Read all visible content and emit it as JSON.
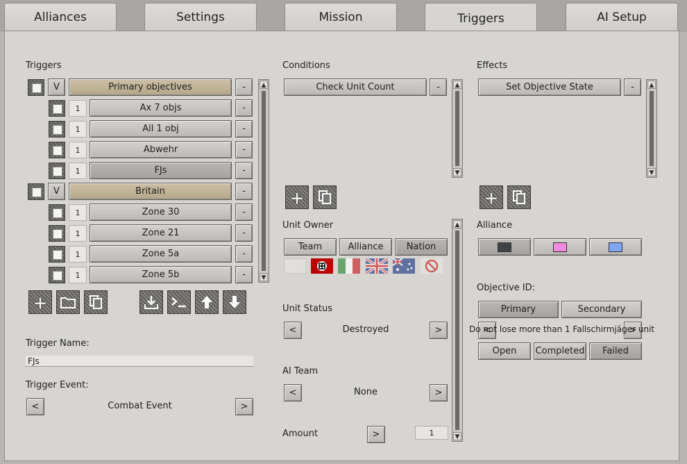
{
  "tabs": {
    "alliances": "Alliances",
    "settings": "Settings",
    "mission": "Mission",
    "triggers": "Triggers",
    "ai_setup": "AI Setup"
  },
  "triggers": {
    "header": "Triggers",
    "expand_label": "V",
    "minus_label": "-",
    "groups": [
      {
        "name": "Primary objectives"
      },
      {
        "name": "Britain"
      }
    ],
    "items": [
      {
        "num": "1",
        "name": "Ax 7 objs"
      },
      {
        "num": "1",
        "name": "All 1 obj"
      },
      {
        "num": "1",
        "name": "Abwehr"
      },
      {
        "num": "1",
        "name": "FJs"
      },
      {
        "num": "1",
        "name": "Zone 30"
      },
      {
        "num": "1",
        "name": "Zone 21"
      },
      {
        "num": "1",
        "name": "Zone 5a"
      },
      {
        "num": "1",
        "name": "Zone 5b"
      }
    ],
    "trigger_name_label": "Trigger Name:",
    "trigger_name_value": "FJs",
    "trigger_event_label": "Trigger Event:",
    "trigger_event_value": "Combat Event",
    "prev": "<",
    "next": ">"
  },
  "conditions": {
    "header": "Conditions",
    "item": "Check Unit Count",
    "minus_label": "-",
    "unit_owner_label": "Unit Owner",
    "owner_buttons": [
      "Team",
      "Alliance",
      "Nation"
    ],
    "unit_status_label": "Unit Status",
    "unit_status_value": "Destroyed",
    "ai_team_label": "AI Team",
    "ai_team_value": "None",
    "amount_label": "Amount",
    "amount_value": "1",
    "prev": "<",
    "next": ">"
  },
  "effects": {
    "header": "Effects",
    "item": "Set Objective State",
    "minus_label": "-",
    "alliance_label": "Alliance",
    "alliance_colors": [
      "#3f4449",
      "#f08ae0",
      "#7fa6f5"
    ],
    "objective_id_label": "Objective ID:",
    "objective_buttons": [
      "Primary",
      "Secondary"
    ],
    "objective_text": "Do not lose more than 1 Fallschirmjäger unit",
    "state_buttons": [
      "Open",
      "Completed",
      "Failed"
    ],
    "prev": "<",
    "next": ">"
  },
  "icons": {
    "add": "plus-icon",
    "folder": "folder-icon",
    "copy": "copy-icon",
    "import": "import-icon",
    "console": "console-icon",
    "up": "arrow-up-icon",
    "down": "arrow-down-icon"
  }
}
